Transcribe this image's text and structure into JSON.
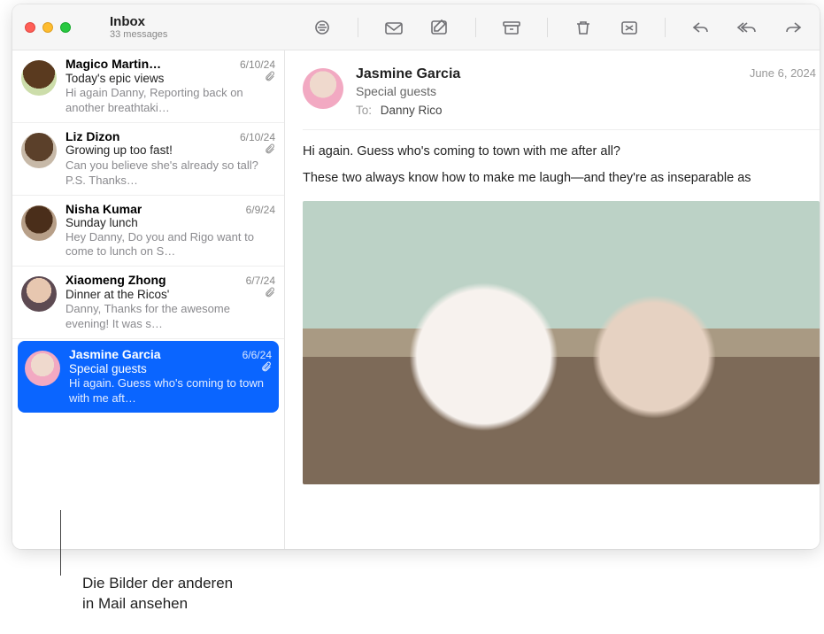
{
  "header": {
    "mailbox_title": "Inbox",
    "message_count": "33 messages"
  },
  "toolbar": {
    "filter": "filter",
    "get_mail": "get-mail",
    "compose": "compose",
    "archive": "archive",
    "delete": "delete",
    "junk": "junk",
    "reply": "reply",
    "reply_all": "reply-all",
    "forward": "forward"
  },
  "messages": [
    {
      "sender": "Magico Martin…",
      "date": "6/10/24",
      "subject": "Today's epic views",
      "has_attachment": true,
      "preview": "Hi again Danny, Reporting back on another breathtaki…",
      "avatar_class": "av0"
    },
    {
      "sender": "Liz Dizon",
      "date": "6/10/24",
      "subject": "Growing up too fast!",
      "has_attachment": true,
      "preview": "Can you believe she's already so tall? P.S. Thanks…",
      "avatar_class": "av1"
    },
    {
      "sender": "Nisha Kumar",
      "date": "6/9/24",
      "subject": "Sunday lunch",
      "has_attachment": false,
      "preview": "Hey Danny, Do you and Rigo want to come to lunch on S…",
      "avatar_class": "av2"
    },
    {
      "sender": "Xiaomeng Zhong",
      "date": "6/7/24",
      "subject": "Dinner at the Ricos'",
      "has_attachment": true,
      "preview": "Danny, Thanks for the awesome evening! It was s…",
      "avatar_class": "av3"
    },
    {
      "sender": "Jasmine Garcia",
      "date": "6/6/24",
      "subject": "Special guests",
      "has_attachment": true,
      "preview": "Hi again. Guess who's coming to town with me aft…",
      "avatar_class": "av4",
      "selected": true
    }
  ],
  "reader": {
    "from": "Jasmine Garcia",
    "subject": "Special guests",
    "to_label": "To:",
    "to_value": "Danny Rico",
    "date": "June 6, 2024",
    "avatar_class": "av4",
    "paragraphs": [
      "Hi again. Guess who's coming to town with me after all?",
      "These two always know how to make me laugh—and they're as inseparable as "
    ]
  },
  "callout": {
    "line1": "Die Bilder der anderen",
    "line2": "in Mail ansehen"
  }
}
